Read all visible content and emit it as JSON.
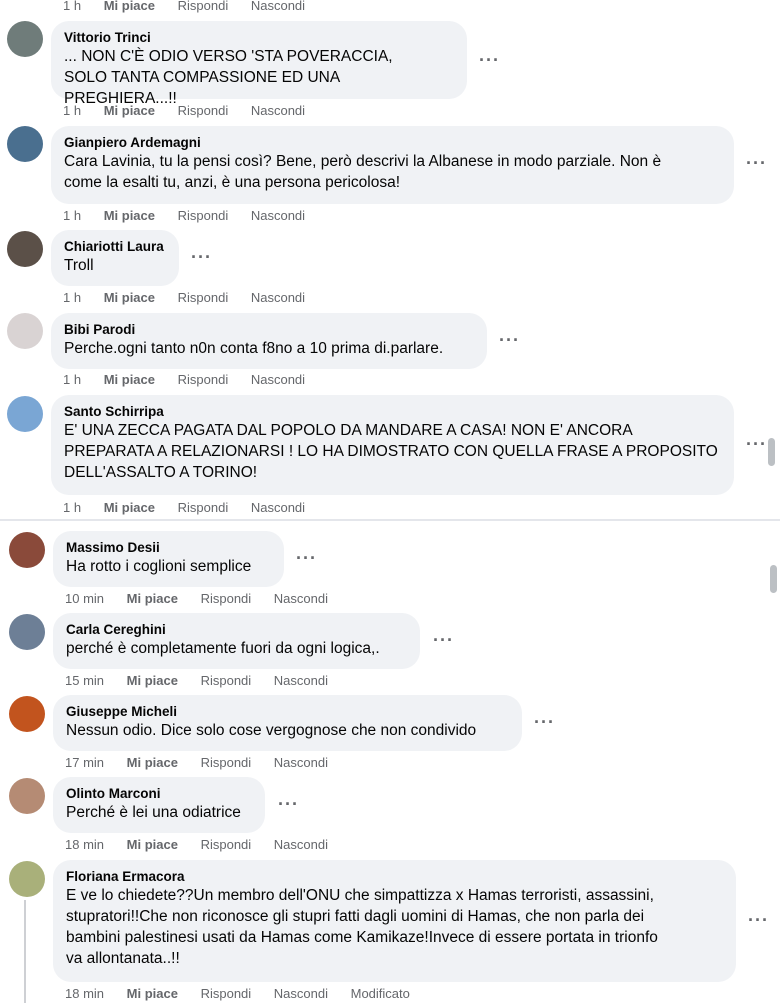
{
  "labels": {
    "like": "Mi piace",
    "reply": "Rispondi",
    "hide": "Nascondi",
    "edited": "Modificato",
    "more": "···"
  },
  "top_partial": {
    "time": "1 h"
  },
  "comments": [
    {
      "author": "Vittorio Trinci",
      "lines": [
        "... NON C'È ODIO VERSO 'STA POVERACCIA,",
        "SOLO TANTA COMPASSIONE ED UNA PREGHIERA...!!"
      ],
      "time": "1 h",
      "avatar_color": "#6f7c7a"
    },
    {
      "author": "Gianpiero Ardemagni",
      "lines": [
        "Cara Lavinia, tu la pensi così? Bene, però descrivi la Albanese in modo parziale. Non è",
        "come la esalti tu, anzi, è una persona pericolosa!"
      ],
      "time": "1 h",
      "avatar_color": "#4a6f8f"
    },
    {
      "author": "Chiariotti Laura",
      "lines": [
        "Troll"
      ],
      "time": "1 h",
      "avatar_color": "#5b5048"
    },
    {
      "author": "Bibi Parodi",
      "lines": [
        "Perche.ogni tanto n0n conta f8no a 10 prima di.parlare."
      ],
      "time": "1 h",
      "avatar_color": "#d9d3d3"
    },
    {
      "author": "Santo Schirripa",
      "lines": [
        "E' UNA ZECCA PAGATA DAL POPOLO DA MANDARE A CASA! NON E' ANCORA",
        "PREPARATA A RELAZIONARSI ! LO HA DIMOSTRATO CON QUELLA FRASE A PROPOSITO",
        "DELL'ASSALTO A TORINO!"
      ],
      "time": "1 h",
      "avatar_color": "#7aa6d4"
    },
    {
      "author": "Massimo Desii",
      "lines": [
        "Ha rotto i coglioni semplice"
      ],
      "time": "10 min",
      "avatar_color": "#8a4a3a"
    },
    {
      "author": "Carla Cereghini",
      "lines": [
        "perché è completamente fuori da ogni logica,."
      ],
      "time": "15 min",
      "avatar_color": "#6d7f96"
    },
    {
      "author": "Giuseppe Micheli",
      "lines": [
        "Nessun odio. Dice solo cose vergognose che non condivido"
      ],
      "time": "17 min",
      "avatar_color": "#c2541e"
    },
    {
      "author": "Olinto Marconi",
      "lines": [
        "Perché è lei una odiatrice"
      ],
      "time": "18 min",
      "avatar_color": "#b58b74"
    },
    {
      "author": "Floriana Ermacora",
      "lines": [
        "E ve lo chiedete??Un membro dell'ONU che simpattizza x Hamas terroristi, assassini,",
        "stupratori!!Che non riconosce gli stupri fatti dagli uomini di Hamas, che non parla dei",
        "bambini palestinesi usati da Hamas come Kamikaze!Invece di essere portata in trionfo",
        "va allontanata..!!"
      ],
      "time": "18 min",
      "edited": true,
      "avatar_color": "#a9b07a"
    }
  ]
}
